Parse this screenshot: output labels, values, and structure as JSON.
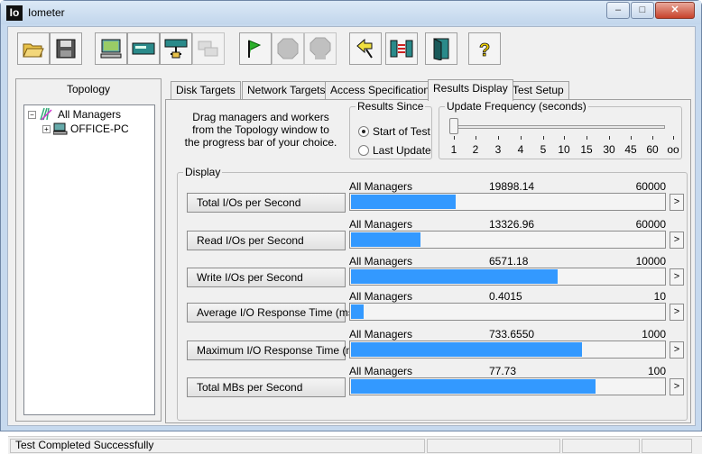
{
  "window": {
    "title": "Iometer",
    "icon_text": "Io",
    "buttons": {
      "minimize": "–",
      "maximize": "□",
      "close": "✕"
    }
  },
  "toolbar": [
    "open-icon",
    "save-icon",
    "display-icon",
    "new-disk-worker-icon",
    "new-network-worker-icon",
    "duplicate-worker-icon",
    "start-icon",
    "stop-icon",
    "stop-all-icon",
    "reset-workers-icon",
    "access-icon",
    "exit-icon",
    "about-icon"
  ],
  "topology": {
    "header": "Topology",
    "root": "All Managers",
    "child": "OFFICE-PC"
  },
  "tabs": [
    "Disk Targets",
    "Network Targets",
    "Access Specifications",
    "Results Display",
    "Test Setup"
  ],
  "selected_tab": "Results Display",
  "instructions": "Drag managers and workers from the Topology window to the progress bar of your choice.",
  "results_since": {
    "title": "Results Since",
    "options": [
      "Start of Test",
      "Last Update"
    ],
    "selected": "Start of Test"
  },
  "update_frequency": {
    "title": "Update Frequency (seconds)",
    "ticks": [
      "1",
      "2",
      "3",
      "4",
      "5",
      "10",
      "15",
      "30",
      "45",
      "60",
      "oo"
    ],
    "value": "1"
  },
  "display": {
    "title": "Display",
    "metrics": [
      {
        "label": "Total I/Os per Second",
        "source": "All Managers",
        "value": "19898.14",
        "max": "60000",
        "fraction": 0.332,
        "arrow": ">"
      },
      {
        "label": "Read I/Os per Second",
        "source": "All Managers",
        "value": "13326.96",
        "max": "60000",
        "fraction": 0.222,
        "arrow": ">"
      },
      {
        "label": "Write I/Os per Second",
        "source": "All Managers",
        "value": "6571.18",
        "max": "10000",
        "fraction": 0.657,
        "arrow": ">"
      },
      {
        "label": "Average I/O Response Time (ms)",
        "source": "All Managers",
        "value": "0.4015",
        "max": "10",
        "fraction": 0.04,
        "arrow": ">"
      },
      {
        "label": "Maximum I/O Response Time (ms)",
        "source": "All Managers",
        "value": "733.6550",
        "max": "1000",
        "fraction": 0.734,
        "arrow": ">"
      },
      {
        "label": "Total MBs per Second",
        "source": "All Managers",
        "value": "77.73",
        "max": "100",
        "fraction": 0.777,
        "arrow": ">"
      }
    ]
  },
  "status": {
    "text": "Test Completed Successfully"
  },
  "colors": {
    "bar_fill": "#3399ff",
    "title_bar": "#c6d9ee",
    "close_button": "#c7422b"
  }
}
